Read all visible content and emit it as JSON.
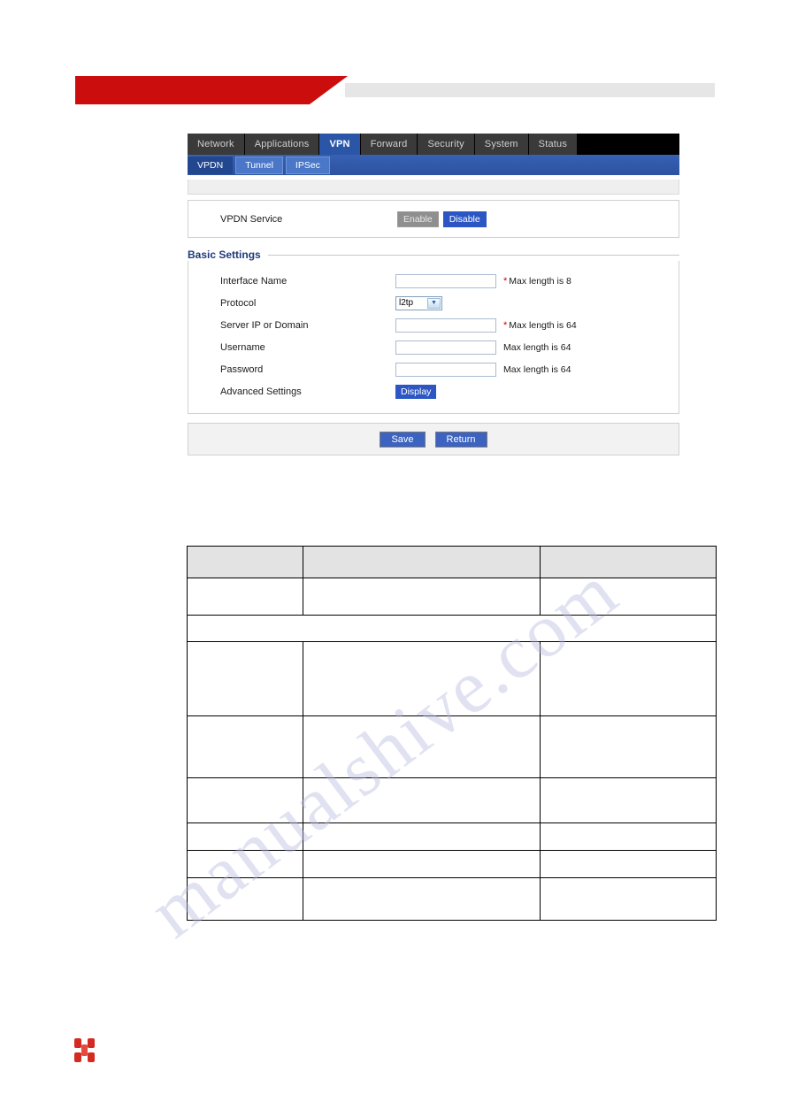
{
  "page": {
    "banner": {
      "accent_color": "#cc0d0d",
      "bar_color": "#e6e6e6"
    },
    "watermark_text": "manualshive.com"
  },
  "ui": {
    "nav": {
      "tabs": [
        {
          "label": "Network",
          "active": false
        },
        {
          "label": "Applications",
          "active": false
        },
        {
          "label": "VPN",
          "active": true
        },
        {
          "label": "Forward",
          "active": false
        },
        {
          "label": "Security",
          "active": false
        },
        {
          "label": "System",
          "active": false
        },
        {
          "label": "Status",
          "active": false
        }
      ]
    },
    "subnav": {
      "tabs": [
        {
          "label": "VPDN",
          "active": true
        },
        {
          "label": "Tunnel",
          "active": false
        },
        {
          "label": "IPSec",
          "active": false
        }
      ]
    },
    "service": {
      "label": "VPDN Service",
      "enable_label": "Enable",
      "disable_label": "Disable",
      "selected": "Disable"
    },
    "basic_settings": {
      "title": "Basic Settings",
      "fields": [
        {
          "label": "Interface Name",
          "type": "text",
          "value": "",
          "required": true,
          "hint": "Max length is 8"
        },
        {
          "label": "Protocol",
          "type": "select",
          "value": "l2tp",
          "required": false,
          "hint": ""
        },
        {
          "label": "Server IP or Domain",
          "type": "text",
          "value": "",
          "required": true,
          "hint": "Max length is 64"
        },
        {
          "label": "Username",
          "type": "text",
          "value": "",
          "required": false,
          "hint": "Max length is 64"
        },
        {
          "label": "Password",
          "type": "text",
          "value": "",
          "required": false,
          "hint": "Max length is 64"
        },
        {
          "label": "Advanced Settings",
          "type": "button",
          "value": "Display",
          "required": false,
          "hint": ""
        }
      ],
      "required_marker": "*"
    },
    "actions": {
      "save_label": "Save",
      "return_label": "Return"
    },
    "colors": {
      "active_tab": "#2b56a8",
      "subnav": "#2d529f",
      "primary_button": "#3c63c0",
      "selected_toggle": "#2b56c4",
      "disabled_toggle": "#8f8f8f",
      "required_asterisk": "#d00000",
      "section_title": "#1f3a7a"
    }
  },
  "table": {
    "header_fill": "#e3e3e3",
    "columns": [
      "",
      "",
      ""
    ],
    "rows": [
      [
        "",
        "",
        ""
      ],
      [
        "",
        "",
        ""
      ],
      [
        "",
        "",
        ""
      ],
      [
        "",
        "",
        ""
      ],
      [
        "",
        "",
        ""
      ],
      [
        "",
        "",
        ""
      ],
      [
        "",
        "",
        ""
      ],
      [
        "",
        "",
        ""
      ]
    ]
  }
}
